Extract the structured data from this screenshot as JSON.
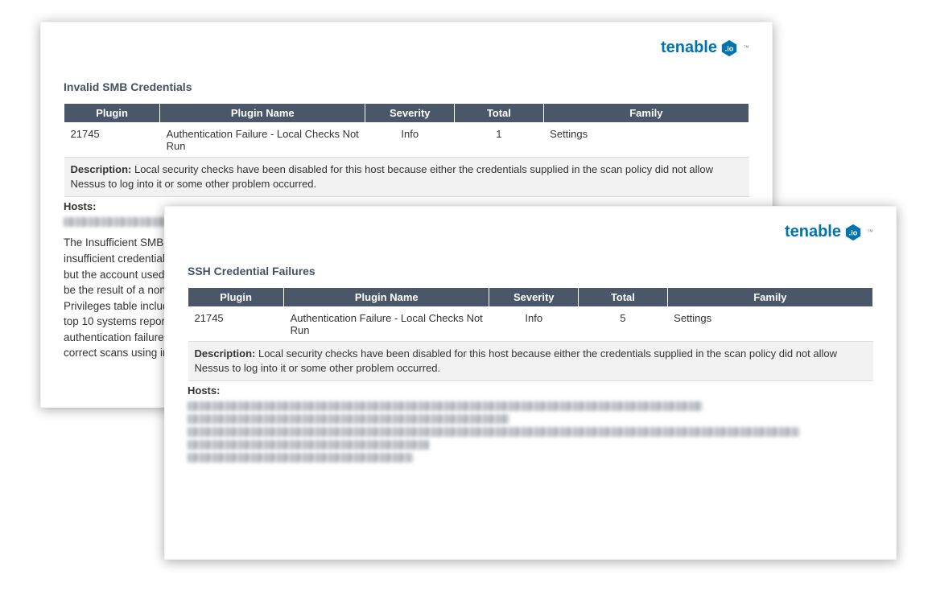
{
  "brand": {
    "name": "tenable",
    "product": ".io"
  },
  "columns": {
    "plugin": "Plugin",
    "plugin_name": "Plugin Name",
    "severity": "Severity",
    "total": "Total",
    "family": "Family"
  },
  "page_back": {
    "title": "Invalid SMB Credentials",
    "row": {
      "plugin": "21745",
      "plugin_name": "Authentication Failure - Local Checks Not Run",
      "severity": "Info",
      "total": "1",
      "family": "Settings"
    },
    "description_label": "Description:",
    "description": "Local security checks have been disabled for this host because either the credentials supplied in the scan policy did not allow Nessus to log into it or some other problem occurred.",
    "hosts_label": "Hosts:",
    "body_text": "The Insufficient SMB C\ninsufficient credentials\nbut the account used w\nbe the result of a non-\nPrivileges table include\ntop 10 systems reportin\nauthentication failure s\ncorrect scans using ins"
  },
  "page_front": {
    "title": "SSH Credential Failures",
    "row": {
      "plugin": "21745",
      "plugin_name": "Authentication Failure - Local Checks Not Run",
      "severity": "Info",
      "total": "5",
      "family": "Settings"
    },
    "description_label": "Description:",
    "description": "Local security checks have been disabled for this host because either the credentials supplied in the scan policy did not allow Nessus to log into it or some other problem occurred.",
    "hosts_label": "Hosts:"
  }
}
